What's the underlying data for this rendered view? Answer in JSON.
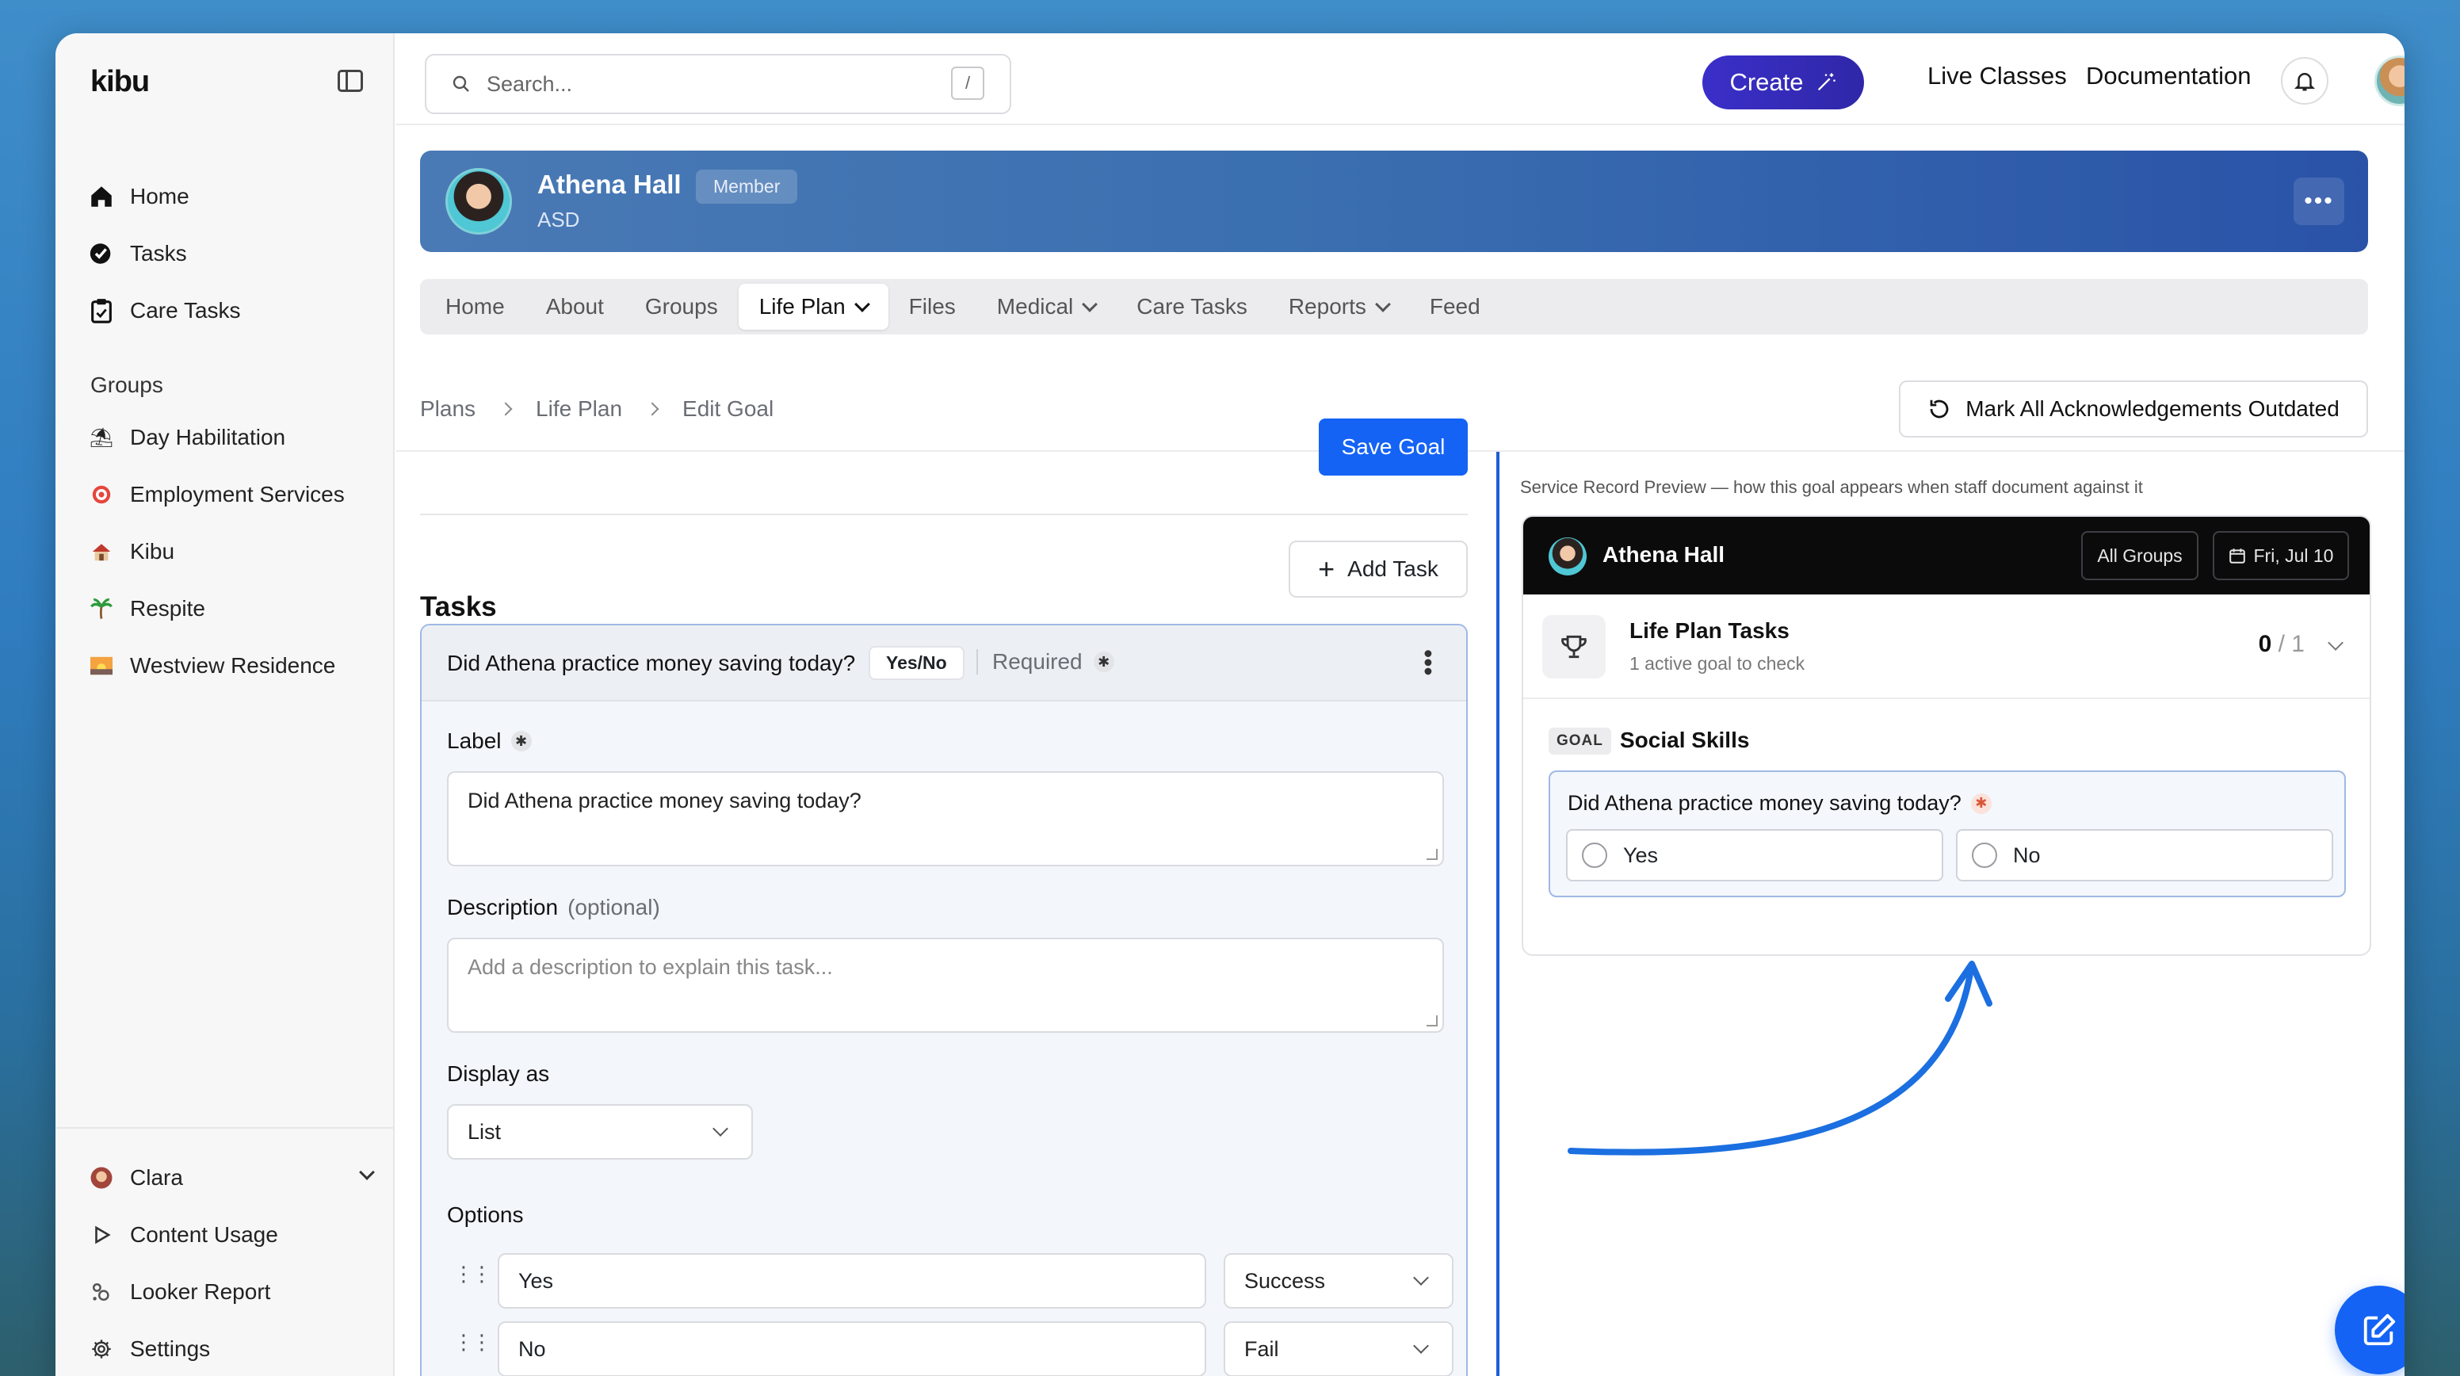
{
  "app": {
    "logo": "kibu"
  },
  "sidebar": {
    "nav": [
      {
        "label": "Home",
        "icon": "home-icon"
      },
      {
        "label": "Tasks",
        "icon": "tasks-icon"
      },
      {
        "label": "Care Tasks",
        "icon": "clipboard-icon"
      }
    ],
    "groups_heading": "Groups",
    "groups": [
      {
        "label": "Day Habilitation",
        "icon": "beach-umbrella-icon"
      },
      {
        "label": "Employment Services",
        "icon": "target-icon"
      },
      {
        "label": "Kibu",
        "icon": "house-icon"
      },
      {
        "label": "Respite",
        "icon": "palm-tree-icon"
      },
      {
        "label": "Westview Residence",
        "icon": "sunrise-icon"
      }
    ],
    "bottom": [
      {
        "label": "Clara",
        "icon": "user-avatar-icon"
      },
      {
        "label": "Content Usage",
        "icon": "play-icon"
      },
      {
        "label": "Looker Report",
        "icon": "looker-icon"
      },
      {
        "label": "Settings",
        "icon": "gear-icon"
      }
    ]
  },
  "topbar": {
    "search_placeholder": "Search...",
    "search_shortcut": "/",
    "create_label": "Create",
    "live_classes": "Live Classes",
    "documentation": "Documentation"
  },
  "profile": {
    "name": "Athena Hall",
    "badge": "Member",
    "subtitle": "ASD"
  },
  "tabs": [
    {
      "label": "Home"
    },
    {
      "label": "About"
    },
    {
      "label": "Groups"
    },
    {
      "label": "Life Plan",
      "active": true
    },
    {
      "label": "Files"
    },
    {
      "label": "Medical"
    },
    {
      "label": "Care Tasks"
    },
    {
      "label": "Reports"
    },
    {
      "label": "Feed"
    }
  ],
  "breadcrumb": [
    "Plans",
    "Life Plan",
    "Edit Goal"
  ],
  "mark_outdated_label": "Mark All Acknowledgements Outdated",
  "editor": {
    "save_label": "Save Goal",
    "tasks_title": "Tasks",
    "add_task_label": "Add Task",
    "task": {
      "question": "Did Athena practice money saving today?",
      "type_badge": "Yes/No",
      "required_label": "Required",
      "label_heading": "Label",
      "label_value": "Did Athena practice money saving today?",
      "description_heading": "Description",
      "description_optional": "(optional)",
      "description_placeholder": "Add a description to explain this task...",
      "display_heading": "Display as",
      "display_value": "List",
      "options_heading": "Options",
      "options": [
        {
          "value": "Yes",
          "outcome": "Success"
        },
        {
          "value": "No",
          "outcome": "Fail"
        }
      ]
    }
  },
  "preview": {
    "caption": "Service Record Preview — how this goal appears when staff document against it",
    "name": "Athena Hall",
    "groups_btn": "All Groups",
    "date_btn": "Fri, Jul 10",
    "section_title": "Life Plan Tasks",
    "section_sub": "1 active goal to check",
    "count_done": "0",
    "count_total": "/ 1",
    "goal_badge": "GOAL",
    "goal_name": "Social Skills",
    "question": "Did Athena practice money saving today?",
    "answers": [
      "Yes",
      "No"
    ]
  },
  "colors": {
    "accent": "#1463f5",
    "create_button": "#3b2fc9",
    "banner": "#3a6fb0",
    "preview_header": "#0b0b0c"
  }
}
